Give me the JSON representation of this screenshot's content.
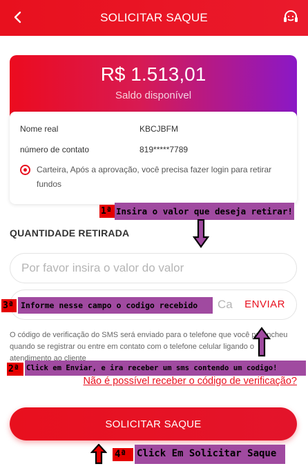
{
  "header": {
    "title": "SOLICITAR SAQUE",
    "back_icon": "chevron-left-icon",
    "support_icon": "headset-icon"
  },
  "balance": {
    "amount": "R$ 1.513,01",
    "label": "Saldo disponível"
  },
  "account": {
    "name_label": "Nome real",
    "name_value": "KBCJBFM",
    "contact_label": "número de contato",
    "contact_value": "819*****7789",
    "notice": "Carteira, Após a aprovação, você precisa fazer login para retirar fundos"
  },
  "withdraw": {
    "section_title": "QUANTIDADE RETIRADA",
    "amount_placeholder": "Por favor insira o valor do valor",
    "code_placeholder": "Ca",
    "send_label": "ENVIAR",
    "sms_note": "O código de verificação do SMS será enviado para o telefone que você preencheu quando se registrar ou entre em contato com o telefone celular ligando o atendimento ao cliente",
    "help_link": "Não é possível receber o código de verificação?",
    "submit_label": "SOLICITAR SAQUE"
  },
  "annotations": {
    "step1_badge": "1ª",
    "step1_text": "Insira o valor que deseja retirar!",
    "step2_badge": "2ª",
    "step2_text": "Click em Enviar, e ira receber um sms contendo um codigo!",
    "step3_badge": "3ª",
    "step3_text": "Informe nesse campo o codigo recebido",
    "step4_badge": "4ª",
    "step4_text": "Click Em Solicitar Saque"
  },
  "colors": {
    "brand_red": "#e8101e",
    "gradient_purple": "#8b18c6",
    "annotation_purple": "#a04aa0"
  }
}
